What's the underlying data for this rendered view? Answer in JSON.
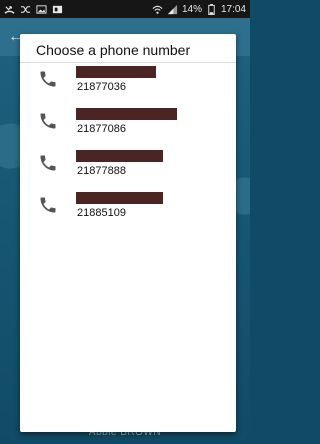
{
  "status_bar": {
    "battery": "14%",
    "time": "17:04",
    "icons": [
      "phone-missed-icon",
      "shuffle-icon",
      "image-icon",
      "office-icon",
      "wifi-icon",
      "signal-icon",
      "battery-icon"
    ]
  },
  "background": {
    "name": "Abbie BROWN"
  },
  "dialog": {
    "title": "Choose a phone number",
    "entries": [
      {
        "icon": "phone-icon",
        "number": "21877036"
      },
      {
        "icon": "phone-icon",
        "number": "21877086"
      },
      {
        "icon": "phone-icon",
        "number": "21877888"
      },
      {
        "icon": "phone-icon",
        "number": "21885109"
      }
    ]
  },
  "colors": {
    "dialog_bg": "#ffffff",
    "redaction": "#4a2523",
    "icon": "#555555",
    "background": "#0f4b66"
  }
}
